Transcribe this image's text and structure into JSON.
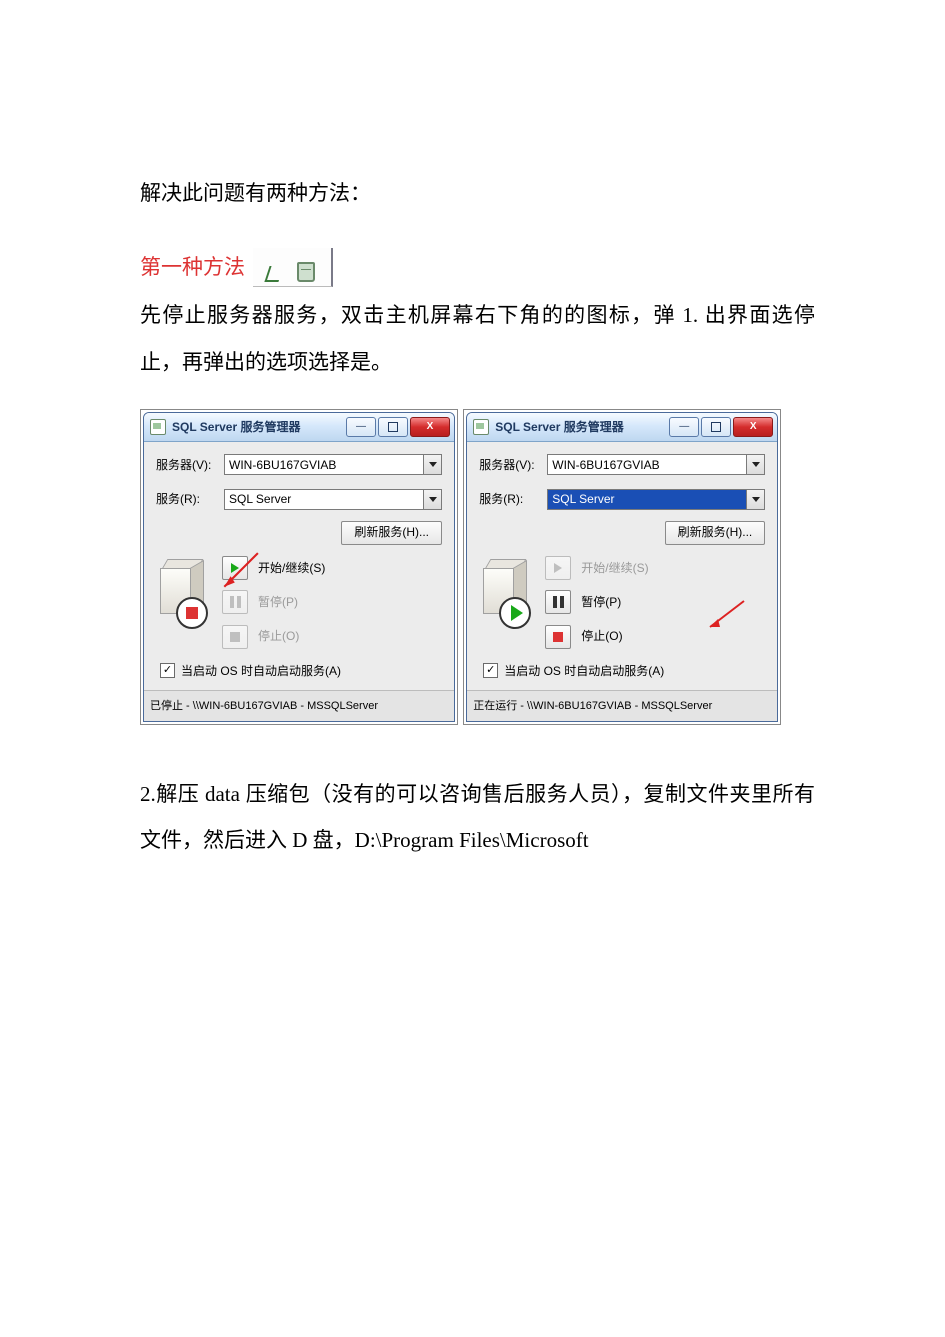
{
  "text": {
    "intro": "解决此问题有两种方法：",
    "method1": "第一种方法",
    "para1": "先停止服务器服务，双击主机屏幕右下角的的图标，弹 1.  出界面选停止，再弹出的选项选择是。",
    "para2": "2.解压 data 压缩包（没有的可以咨询售后服务人员），复制文件夹里所有文件，然后进入 D 盘，D:\\Program Files\\Microsoft"
  },
  "dlg": {
    "title": "SQL Server 服务管理器",
    "server_label": "服务器(V):",
    "server_value": "WIN-6BU167GVIAB",
    "service_label": "服务(R):",
    "service_value": "SQL Server",
    "refresh": "刷新服务(H)...",
    "start": "开始/继续(S)",
    "pause": "暂停(P)",
    "stop": "停止(O)",
    "autostart": "当启动 OS 时自动启动服务(A)",
    "status_stopped": "已停止 - \\\\WIN-6BU167GVIAB - MSSQLServer",
    "status_running": "正在运行 - \\\\WIN-6BU167GVIAB - MSSQLServer",
    "close_x": "X",
    "min": "—",
    "check": "✓"
  }
}
